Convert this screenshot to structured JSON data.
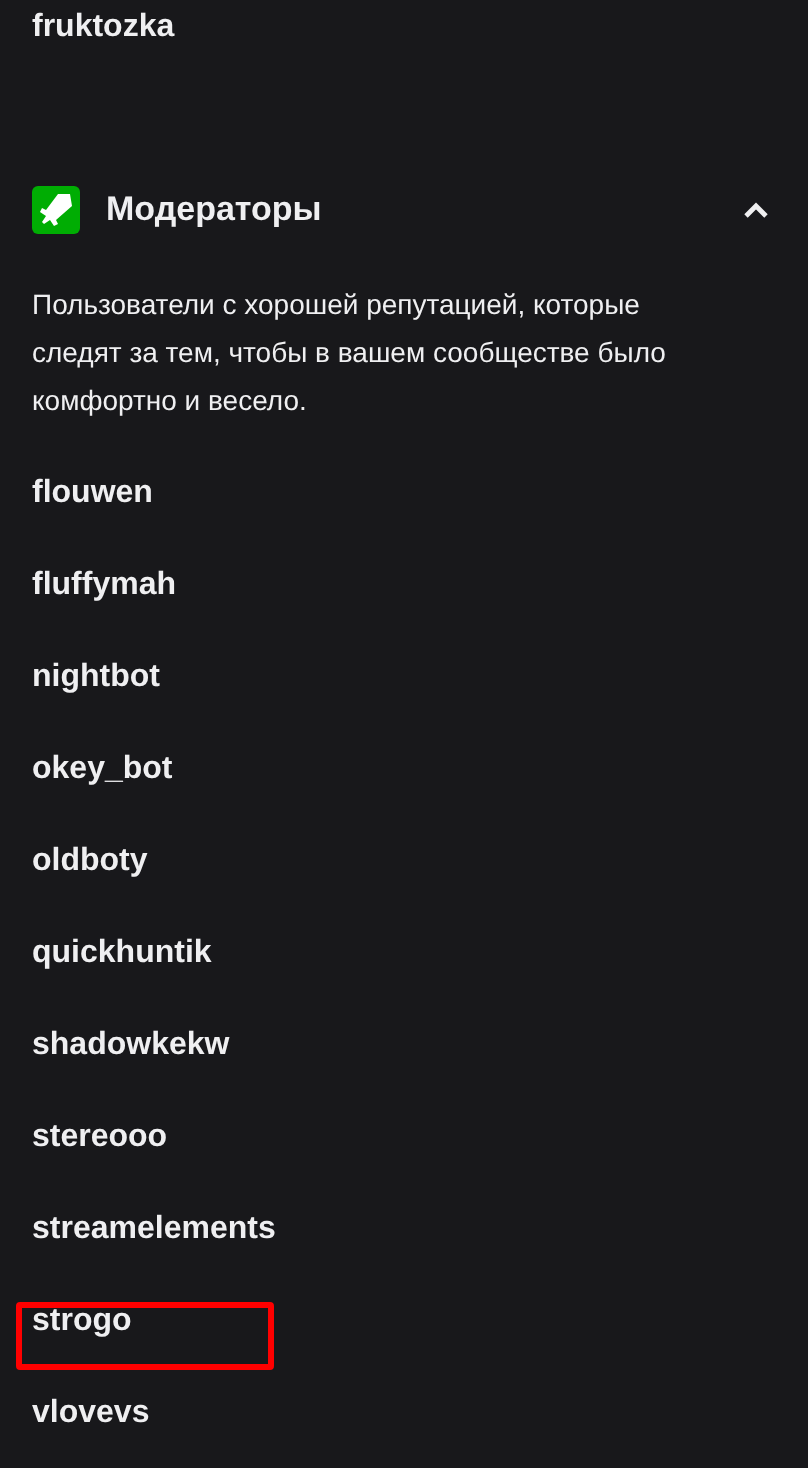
{
  "previous_user": "fruktozka",
  "section": {
    "title": "Модераторы",
    "expanded": true,
    "description": "Пользователи с хорошей репутацией, которые следят за тем, чтобы в вашем сообществе было комфортно и весело.",
    "users": [
      {
        "name": "flouwen",
        "highlighted": false
      },
      {
        "name": "fluffymah",
        "highlighted": false
      },
      {
        "name": "nightbot",
        "highlighted": false
      },
      {
        "name": "okey_bot",
        "highlighted": false
      },
      {
        "name": "oldboty",
        "highlighted": false
      },
      {
        "name": "quickhuntik",
        "highlighted": false
      },
      {
        "name": "shadowkekw",
        "highlighted": false
      },
      {
        "name": "stereooo",
        "highlighted": false
      },
      {
        "name": "streamelements",
        "highlighted": false
      },
      {
        "name": "strogo",
        "highlighted": true
      },
      {
        "name": "vlovevs",
        "highlighted": false
      }
    ]
  }
}
